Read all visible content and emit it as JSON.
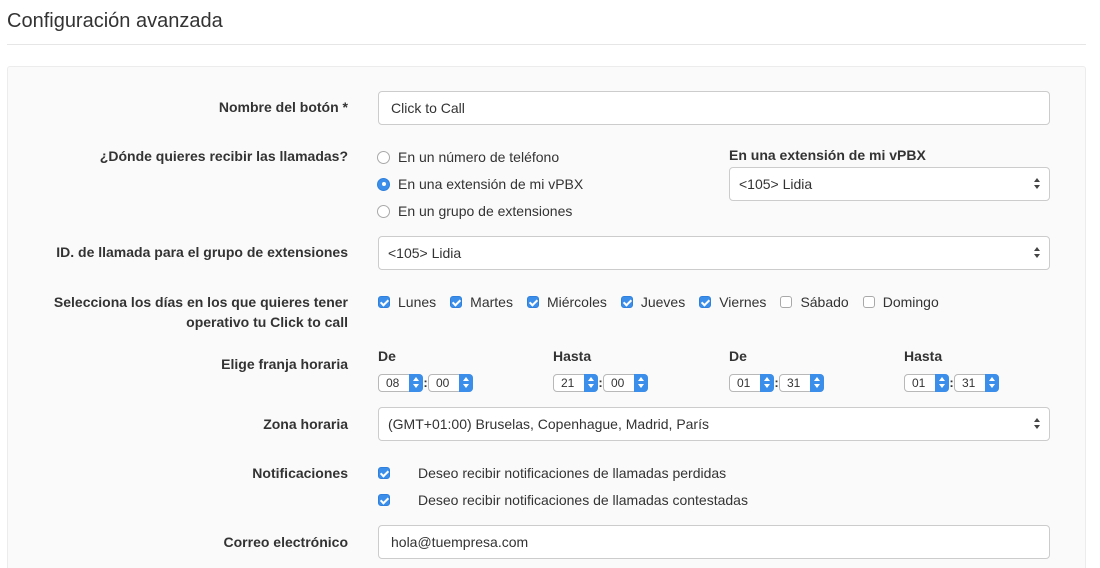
{
  "page": {
    "title": "Configuración avanzada"
  },
  "form": {
    "button_name": {
      "label": "Nombre del botón",
      "required_mark": "*",
      "value": "Click to Call"
    },
    "receive": {
      "label": "¿Dónde quieres recibir las llamadas?",
      "options": [
        {
          "label": "En un número de teléfono",
          "checked": false
        },
        {
          "label": "En una extensión de mi vPBX",
          "checked": true
        },
        {
          "label": "En un grupo de extensiones",
          "checked": false
        }
      ],
      "extension_label": "En una extensión de mi vPBX",
      "extension_value": "<105> Lidia"
    },
    "caller_id": {
      "label": "ID. de llamada para el grupo de extensiones",
      "value": "<105> Lidia"
    },
    "days": {
      "label_line1": "Selecciona los días en los que quieres tener",
      "label_line2": "operativo tu Click to call",
      "items": [
        {
          "label": "Lunes",
          "checked": true
        },
        {
          "label": "Martes",
          "checked": true
        },
        {
          "label": "Miércoles",
          "checked": true
        },
        {
          "label": "Jueves",
          "checked": true
        },
        {
          "label": "Viernes",
          "checked": true
        },
        {
          "label": "Sábado",
          "checked": false
        },
        {
          "label": "Domingo",
          "checked": false
        }
      ]
    },
    "schedule": {
      "label": "Elige franja horaria",
      "ranges": [
        {
          "label": "De",
          "hour": "08",
          "minute": "00"
        },
        {
          "label": "Hasta",
          "hour": "21",
          "minute": "00"
        },
        {
          "label": "De",
          "hour": "01",
          "minute": "31"
        },
        {
          "label": "Hasta",
          "hour": "01",
          "minute": "31"
        }
      ]
    },
    "timezone": {
      "label": "Zona horaria",
      "value": "(GMT+01:00) Bruselas, Copenhague, Madrid, París"
    },
    "notifications": {
      "label": "Notificaciones",
      "items": [
        {
          "label": "Deseo recibir notificaciones de llamadas perdidas",
          "checked": true
        },
        {
          "label": "Deseo recibir notificaciones de llamadas contestadas",
          "checked": true
        }
      ]
    },
    "email": {
      "label": "Correo electrónico",
      "value": "hola@tuempresa.com"
    }
  },
  "colors": {
    "accent": "#3b8fea",
    "border": "#cccccc",
    "panel_bg": "#fafafa"
  }
}
